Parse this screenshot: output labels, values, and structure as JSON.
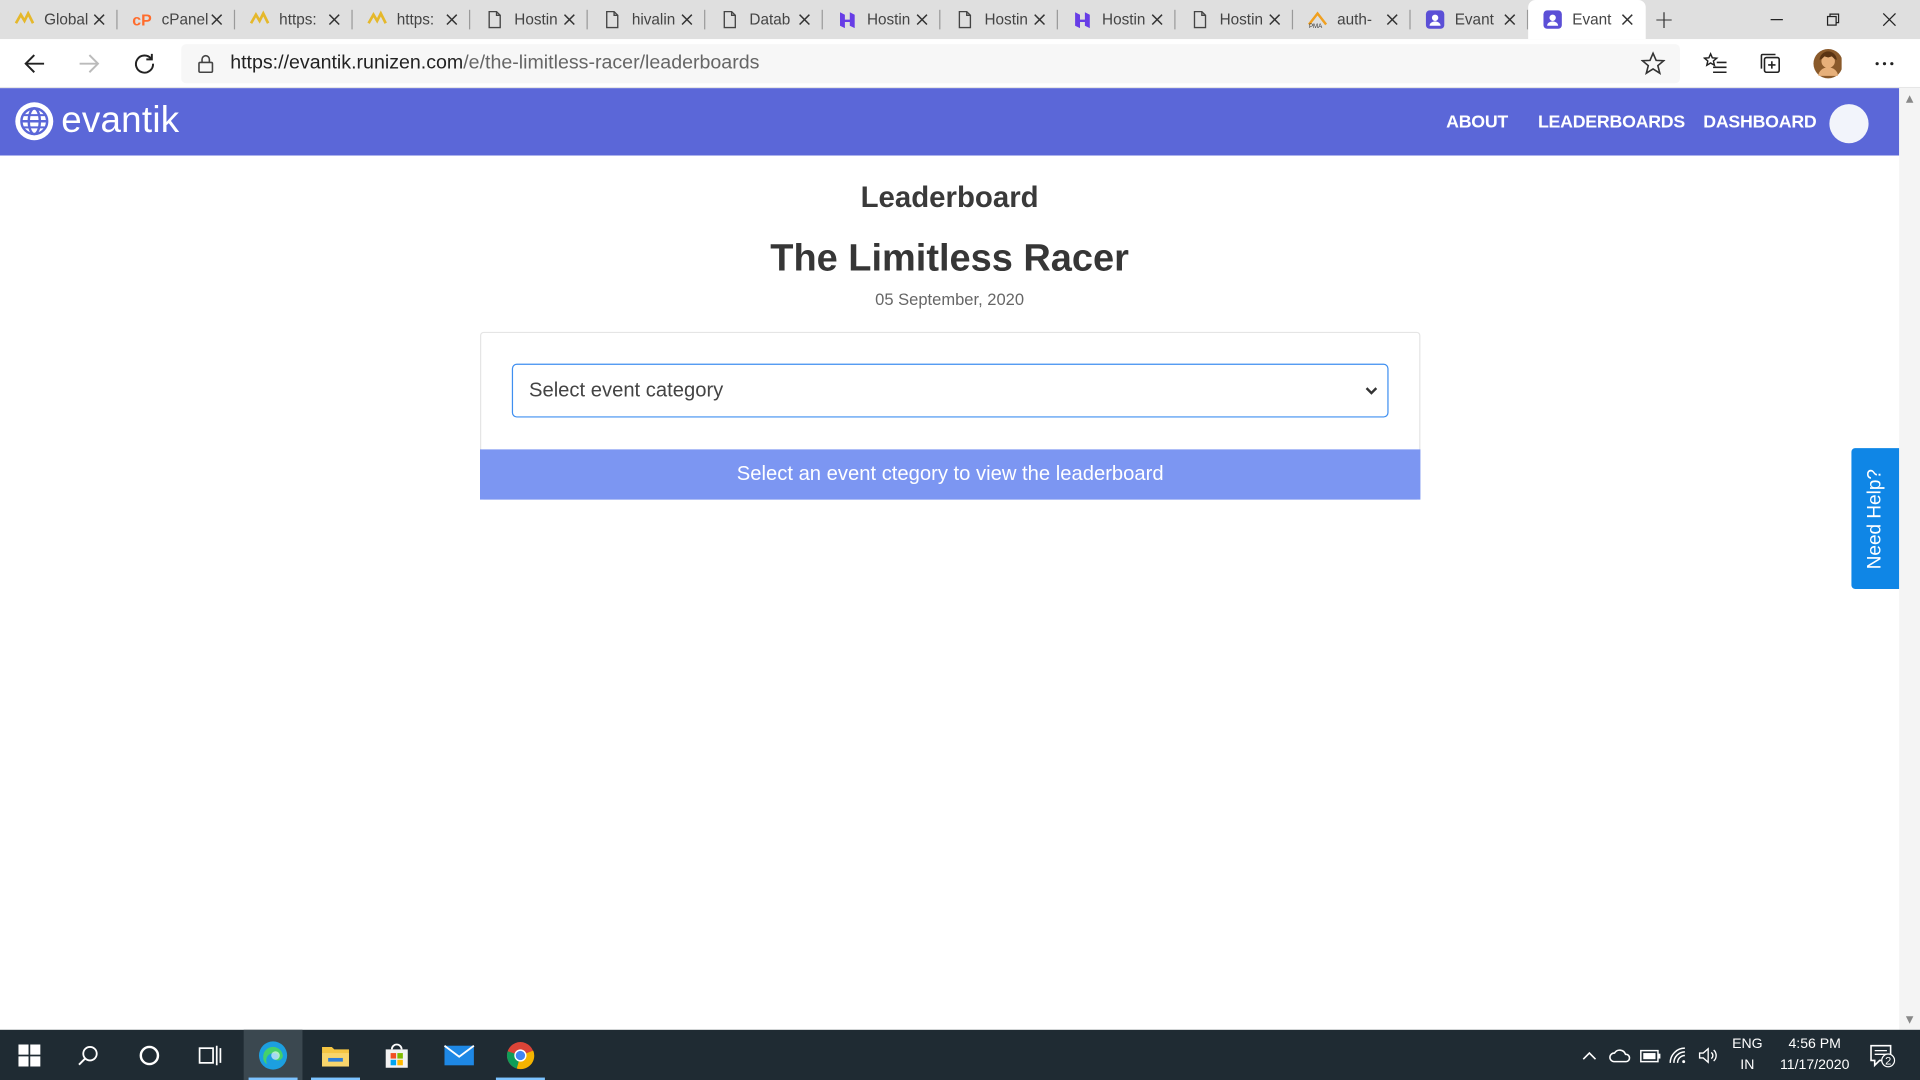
{
  "browser": {
    "tabs": [
      {
        "title": "Global",
        "icon": "hostinger-wing-icon"
      },
      {
        "title": "cPanel",
        "icon": "cpanel-icon"
      },
      {
        "title": "https:",
        "icon": "hostinger-wing-icon"
      },
      {
        "title": "https:",
        "icon": "hostinger-wing-icon"
      },
      {
        "title": "Hostin",
        "icon": "page-icon"
      },
      {
        "title": "hivalin",
        "icon": "page-icon"
      },
      {
        "title": "Datab",
        "icon": "page-icon"
      },
      {
        "title": "Hostin",
        "icon": "hostinger-h-icon"
      },
      {
        "title": "Hostin",
        "icon": "page-icon"
      },
      {
        "title": "Hostin",
        "icon": "hostinger-h-icon"
      },
      {
        "title": "Hostin",
        "icon": "page-icon"
      },
      {
        "title": "auth-",
        "icon": "phpmyadmin-icon"
      },
      {
        "title": "Evant",
        "icon": "evantik-icon"
      },
      {
        "title": "Evant",
        "icon": "evantik-icon",
        "active": true
      }
    ],
    "new_tab_label": "+",
    "url_host": "https://evantik.runizen.com",
    "url_path": "/e/the-limitless-racer/leaderboards"
  },
  "site": {
    "brand": "evantik",
    "nav": {
      "about": "ABOUT",
      "leaderboards": "LEADERBOARDS",
      "dashboard": "DASHBOARD"
    },
    "page_heading": "Leaderboard",
    "event_title": "The Limitless Racer",
    "event_date": "05 September, 2020",
    "category_select": {
      "placeholder": "Select event category"
    },
    "info_banner": "Select an event ctegory to view the leaderboard",
    "help_button": "Need Help?",
    "colors": {
      "header": "#5b67d8",
      "banner": "#7c96f2",
      "help": "#0f86e6",
      "select_border": "#3f8ff0"
    }
  },
  "taskbar": {
    "apps": [
      "start-icon",
      "search-icon",
      "cortana-icon",
      "task-view-icon",
      "edge-icon",
      "file-explorer-icon",
      "store-icon",
      "mail-icon",
      "chrome-icon"
    ],
    "language": "ENG",
    "region": "IN",
    "time": "4:56 PM",
    "date": "11/17/2020",
    "notification_count": "2"
  }
}
